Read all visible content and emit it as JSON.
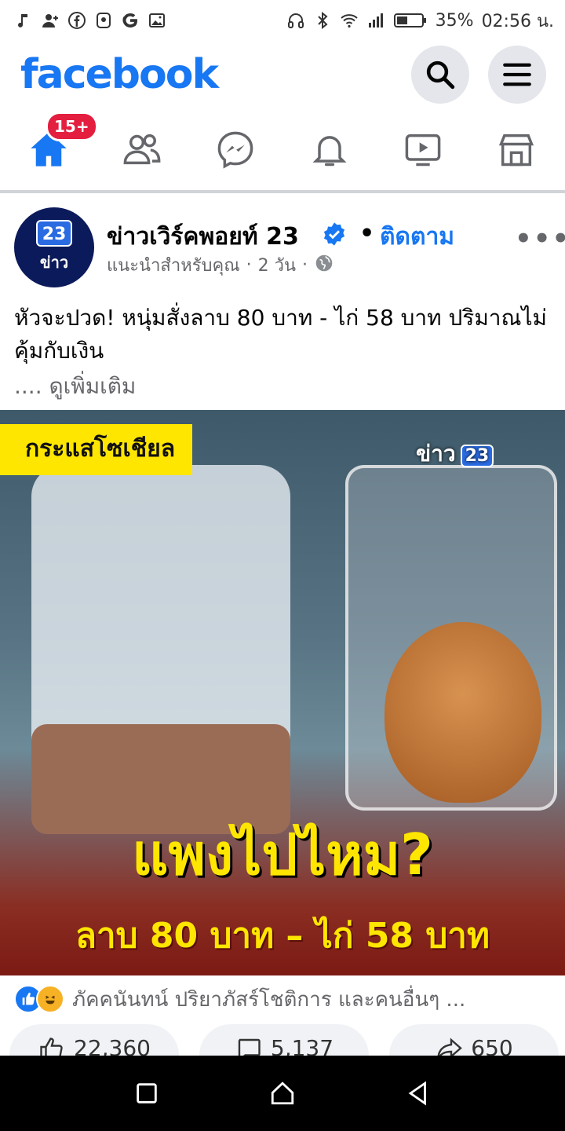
{
  "status_bar": {
    "battery": "35%",
    "time": "02:56 น."
  },
  "header": {
    "logo": "facebook"
  },
  "tabs": {
    "home_badge": "15+"
  },
  "post": {
    "page_name": "ข่าวเวิร์คพอยท์ 23",
    "follow_dot": "•",
    "follow_label": "ติดตาม",
    "meta_suggested": "แนะนำสำหรับคุณ",
    "meta_sep": "·",
    "meta_time": "2 วัน",
    "text": "หัวจะปวด! หนุ่มสั่งลาบ 80 บาท - ไก่ 58 บาท ปริมาณไม่คุ้มกับเงิน",
    "see_more": ".... ดูเพิ่มเติม",
    "image": {
      "tag": "กระแสโซเชียล",
      "brand": "ข่าว",
      "brand_num": "23",
      "headline": "แพงไปไหม?",
      "subline": "ลาบ 80 บาท – ไก่ 58 บาท"
    },
    "avatar": {
      "num": "23",
      "txt": "ข่าว"
    },
    "reactions_text": "ภัคคนันทน์ ปริยาภัสร์โชติการ และคนอื่นๆ ...",
    "actions": {
      "like_count": "22,360",
      "comment_count": "5,137",
      "share_count": "650"
    }
  },
  "colors": {
    "brand": "#1877f2",
    "badge": "#e41e3f",
    "headline_yellow": "#ffe600"
  }
}
